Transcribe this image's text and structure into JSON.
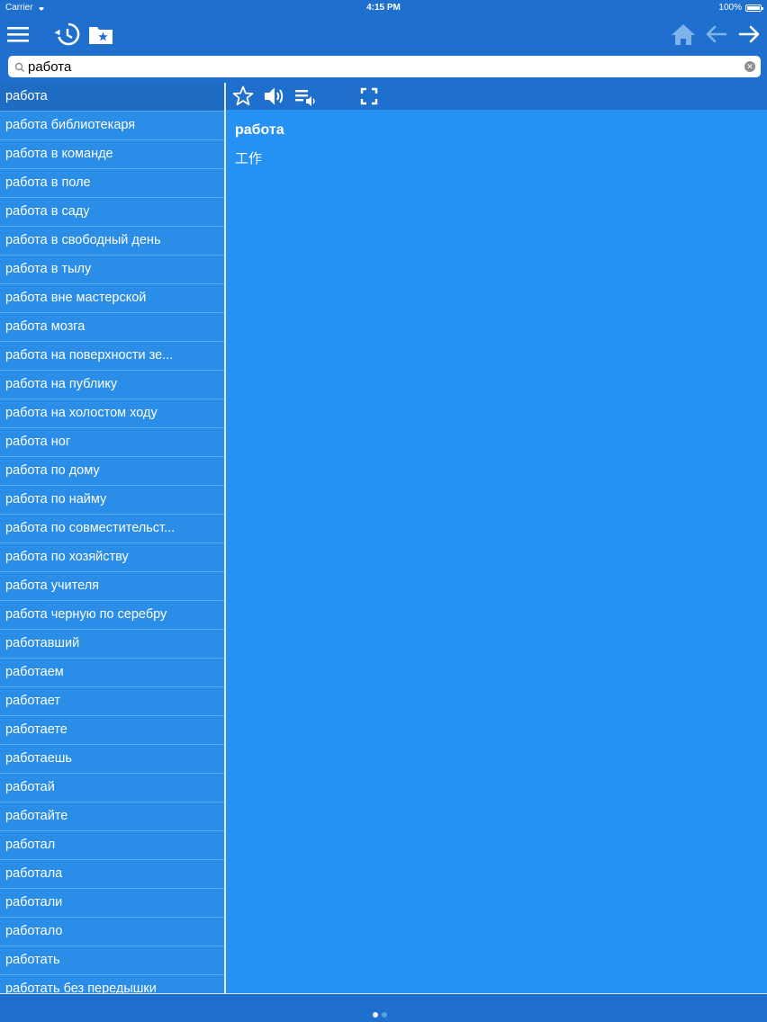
{
  "statusbar": {
    "carrier": "Carrier",
    "time": "4:15 PM",
    "battery": "100%"
  },
  "navbar": {
    "icons": [
      "menu-icon",
      "history-icon",
      "favorites-folder-icon",
      "home-icon",
      "back-arrow-icon",
      "forward-arrow-icon"
    ]
  },
  "search": {
    "value": "работа",
    "placeholder": ""
  },
  "word_list": {
    "selected_index": 0,
    "items": [
      "работа",
      "работа библиотекаря",
      "работа в команде",
      "работа в поле",
      "работа в саду",
      "работа в свободный день",
      "работа в тылу",
      "работа вне мастерской",
      "работа мозга",
      "работа на поверхности зе...",
      "работа на публику",
      "работа на холостом ходу",
      "работа ног",
      "работа по дому",
      "работа по найму",
      "работа по совместительст...",
      "работа по хозяйству",
      "работа учителя",
      "работа черную по серебру",
      "работавший",
      "работаем",
      "работает",
      "работаете",
      "работаешь",
      "работай",
      "работайте",
      "работал",
      "работала",
      "работали",
      "работало",
      "работать",
      "работать без передышки"
    ]
  },
  "entry": {
    "toolbar_icons": [
      "star-icon",
      "speaker-icon",
      "playlist-speaker-icon",
      "fullscreen-icon"
    ],
    "word": "работа",
    "translation": "工作"
  },
  "pager": {
    "pages": 2,
    "current": 0
  },
  "colors": {
    "bar": "#1f6fcf",
    "list_bg": "#2a8de8",
    "selected": "#1f6cc4",
    "content_bg": "#2591f2",
    "home_icon": "#7fb3ea"
  }
}
